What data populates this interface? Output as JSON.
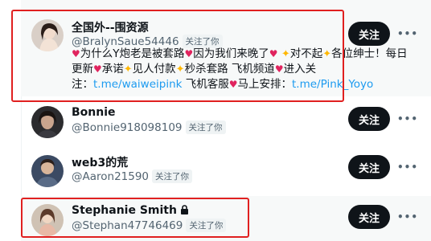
{
  "follow_label": "关注",
  "follows_you_badge": "关注了你",
  "accounts": [
    {
      "name": "全国外--围资源",
      "handle": "@BralynSaue54446",
      "follows_you": true,
      "bio": {
        "line1": "为什么Y炮老是被套路",
        "line1b": "因为我们来晚了",
        "line1c": "对不起",
        "line1d": "各位绅士！每日",
        "line2a": "更新",
        "line2b": "承诺",
        "line2c": "见人付款",
        "line2d": "秒杀套路 飞机频道",
        "line2e": "进入关",
        "line3a": "注：",
        "link1": "t.me/waiweipink",
        "line3b": " 飞机客服",
        "line3c": "马上安排：",
        "link2": "t.me/Pink_Yoyo"
      },
      "highlighted": true
    },
    {
      "name": "Bonnie",
      "handle": "@Bonnie918098109",
      "follows_you": true
    },
    {
      "name": "web3的荒",
      "handle": "@Aaron21590",
      "follows_you": true
    },
    {
      "name": "Stephanie Smith",
      "handle": "@Stephan47746469",
      "follows_you": true,
      "protected": true
    }
  ],
  "icons": {
    "more": "more-dots-icon",
    "lock": "lock-icon",
    "heart": "heart-emoji-icon",
    "sparkle": "sparkle-emoji-icon"
  },
  "colors": {
    "follow_button": "#0f1419",
    "link": "#1d9bf0",
    "annotation_box": "#e02020",
    "secondary_text": "#536471"
  }
}
